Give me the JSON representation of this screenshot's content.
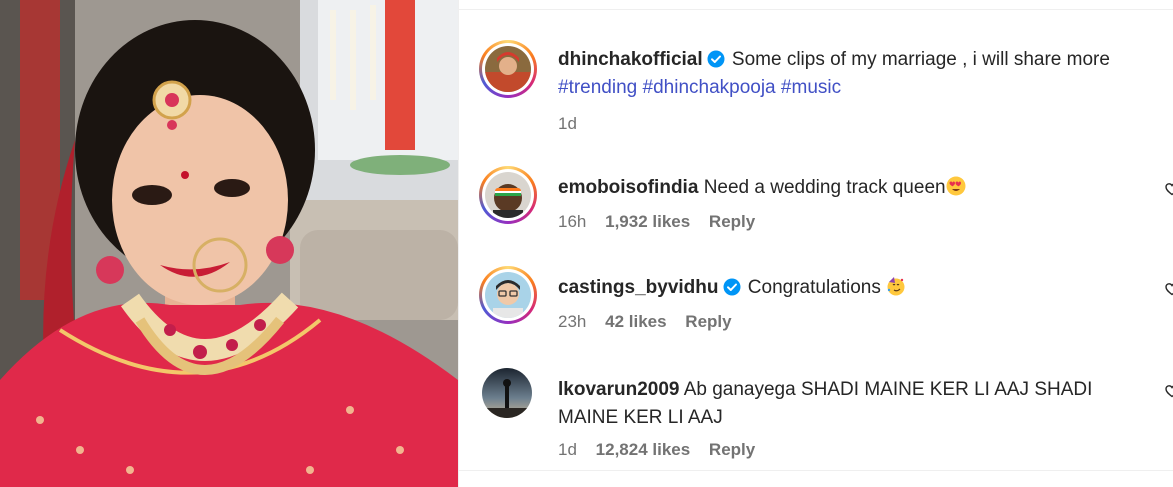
{
  "post": {
    "username": "dhinchakofficial",
    "caption": "Some clips of my marriage , i will share more",
    "hashtags": [
      "#trending",
      "#dhinchakpooja",
      "#music"
    ],
    "time": "1d",
    "verified": true
  },
  "comments": [
    {
      "username": "emoboisofindia",
      "text": "Need a wedding track queen",
      "emoji": "heart-eyes-emoji",
      "time": "16h",
      "likes": "1,932 likes",
      "reply": "Reply",
      "verified": false
    },
    {
      "username": "castings_byvidhu",
      "text": "Congratulations",
      "emoji": "party-face-emoji",
      "time": "23h",
      "likes": "42 likes",
      "reply": "Reply",
      "verified": true
    },
    {
      "username": "lkovarun2009",
      "text": "Ab ganayega SHADI MAINE KER LI AAJ SHADI MAINE KER LI AAJ",
      "time": "1d",
      "likes": "12,824 likes",
      "reply": "Reply",
      "verified": false
    }
  ],
  "colors": {
    "hashtag": "#4150c5",
    "verified_badge": "#0095f6",
    "meta_text": "#737373"
  }
}
